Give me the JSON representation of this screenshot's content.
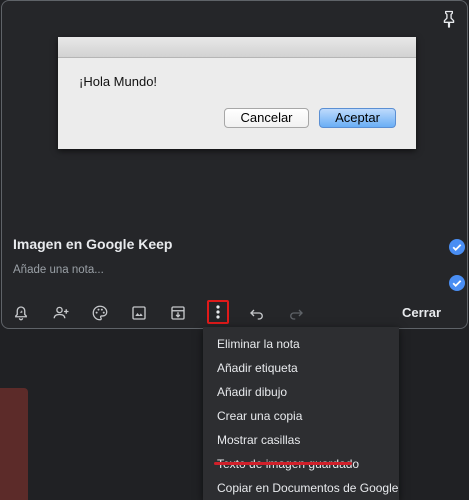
{
  "alert": {
    "message": "¡Hola Mundo!",
    "cancel_label": "Cancelar",
    "ok_label": "Aceptar"
  },
  "note": {
    "title": "Imagen en Google Keep",
    "placeholder": "Añade una nota...",
    "close_label": "Cerrar"
  },
  "toolbar_icons": [
    "reminder-icon",
    "collaborator-icon",
    "palette-icon",
    "image-icon",
    "archive-icon",
    "more-icon",
    "undo-icon",
    "redo-icon"
  ],
  "menu": {
    "items": [
      "Eliminar la nota",
      "Añadir etiqueta",
      "Añadir dibujo",
      "Crear una copia",
      "Mostrar casillas",
      "Texto de imagen guardado",
      "Copiar en Documentos de Google"
    ]
  },
  "colors": {
    "background": "#202124",
    "card": "#252629",
    "accent_check": "#4a8ef3",
    "highlight": "#e01a1a"
  }
}
